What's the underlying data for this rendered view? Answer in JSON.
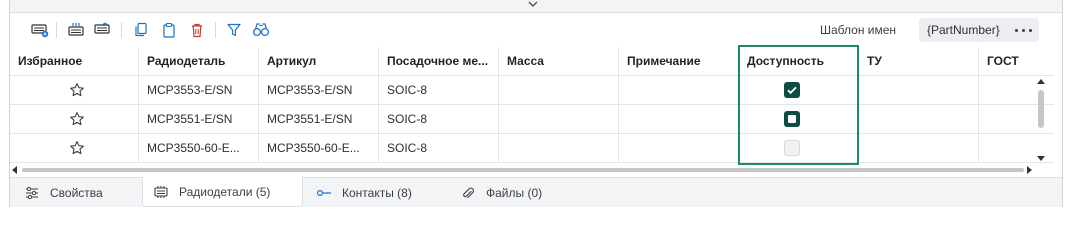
{
  "toolbar": {
    "buttons": [
      "add-row-icon",
      "insert-above-icon",
      "insert-below-icon",
      "copy-icon",
      "paste-icon",
      "delete-icon",
      "filter-icon",
      "find-icon"
    ],
    "template_label": "Шаблон имен",
    "template_value": "{PartNumber}",
    "more_label": "•••"
  },
  "table": {
    "columns": [
      "Избранное",
      "Радиодеталь",
      "Артикул",
      "Посадочное ме...",
      "Масса",
      "Примечание",
      "Доступность",
      "ТУ",
      "ГОСТ"
    ],
    "rows": [
      {
        "favorite": false,
        "part": "MCP3553-E/SN",
        "article": "MCP3553-E/SN",
        "footprint": "SOIC-8",
        "mass": "",
        "note": "",
        "availability": "checked",
        "tu": "",
        "gost": ""
      },
      {
        "favorite": false,
        "part": "MCP3551-E/SN",
        "article": "MCP3551-E/SN",
        "footprint": "SOIC-8",
        "mass": "",
        "note": "",
        "availability": "partial",
        "tu": "",
        "gost": ""
      },
      {
        "favorite": false,
        "part": "MCP3550-60-E...",
        "article": "MCP3550-60-E...",
        "footprint": "SOIC-8",
        "mass": "",
        "note": "",
        "availability": "unchecked",
        "tu": "",
        "gost": ""
      }
    ]
  },
  "tabs": [
    {
      "label": "Свойства",
      "icon": "sliders-icon",
      "active": false
    },
    {
      "label": "Радиодетали (5)",
      "icon": "chip-icon",
      "active": true
    },
    {
      "label": "Контакты (8)",
      "icon": "pin-icon",
      "active": false
    },
    {
      "label": "Файлы (0)",
      "icon": "paperclip-icon",
      "active": false
    }
  ],
  "colors": {
    "accent": "#0f4c45",
    "highlight": "#1f8a5b",
    "delete": "#c0392b",
    "primary_icon": "#1a73c8"
  }
}
